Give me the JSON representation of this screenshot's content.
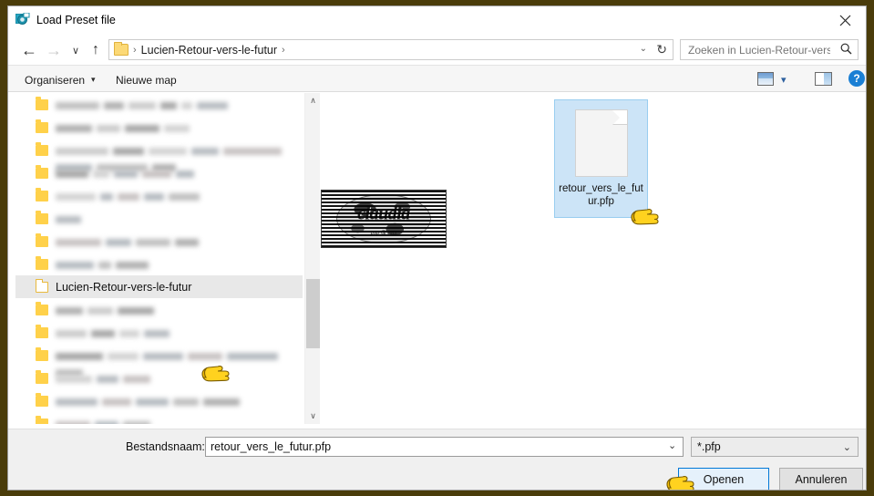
{
  "window": {
    "title": "Load Preset file",
    "icon": "app-icon",
    "close_label": "✕",
    "frame_color": "#4a3c0a"
  },
  "nav": {
    "back_icon": "←",
    "forward_icon": "→",
    "recent_icon": "∨",
    "up_icon": "↑",
    "breadcrumb_folder": "",
    "breadcrumb_path": "Lucien-Retour-vers-le-futur",
    "breadcrumb_sep": "›",
    "dropdown_icon": "⌄",
    "refresh_icon": "↻"
  },
  "search": {
    "placeholder": "Zoeken in Lucien-Retour-vers...",
    "value": "",
    "icon": "⚲"
  },
  "commandbar": {
    "organize_label": "Organiseren",
    "organize_chevron": "▾",
    "new_folder_label": "Nieuwe map",
    "view_chevron": "▾",
    "help_label": "?"
  },
  "tree": {
    "selected_label": "Lucien-Retour-vers-le-futur",
    "scroll_up_icon": "∧",
    "scroll_down_icon": "∨",
    "items": [
      {
        "redacted": true,
        "bars": [
          48,
          22,
          30,
          18,
          12,
          34
        ]
      },
      {
        "redacted": true,
        "bars": [
          40,
          26,
          38,
          28
        ]
      },
      {
        "redacted": true,
        "bars": [
          58,
          34,
          42,
          30,
          64,
          40,
          56,
          26
        ]
      },
      {
        "redacted": true,
        "bars": [
          36,
          18,
          26,
          32,
          20
        ]
      },
      {
        "redacted": true,
        "bars": [
          44,
          14,
          24,
          22,
          34
        ]
      },
      {
        "redacted": true,
        "bars": [
          28
        ]
      },
      {
        "redacted": true,
        "bars": [
          50,
          28,
          38,
          26
        ]
      },
      {
        "redacted": true,
        "bars": [
          42,
          14,
          36
        ]
      },
      {
        "redacted": false,
        "label": "Lucien-Retour-vers-le-futur",
        "selected": true
      },
      {
        "redacted": true,
        "bars": [
          30,
          28,
          40
        ]
      },
      {
        "redacted": true,
        "bars": [
          34,
          26,
          22,
          28
        ]
      },
      {
        "redacted": true,
        "bars": [
          52,
          34,
          44,
          38,
          56,
          30
        ]
      },
      {
        "redacted": true,
        "bars": [
          40,
          24,
          30
        ]
      },
      {
        "redacted": true,
        "bars": [
          46,
          32,
          36,
          28,
          40
        ]
      },
      {
        "redacted": true,
        "bars": [
          38,
          26,
          30
        ]
      },
      {
        "redacted": true,
        "bars": [
          20
        ]
      }
    ]
  },
  "files": {
    "watermark": {
      "title": "claudia",
      "subtitle": "psp & tuts"
    },
    "selected_file": {
      "name": "retour_vers_le_futur.pfp",
      "display_name": "retour_vers_le_futur.pfp",
      "icon": "generic-document-icon",
      "selected": true
    }
  },
  "bottom": {
    "filename_label": "Bestandsnaam:",
    "filename_value": "retour_vers_le_futur.pfp",
    "filename_chevron": "⌄",
    "filter_value": "*.pfp",
    "filter_chevron": "⌄",
    "open_label": "Openen",
    "cancel_label": "Annuleren"
  }
}
